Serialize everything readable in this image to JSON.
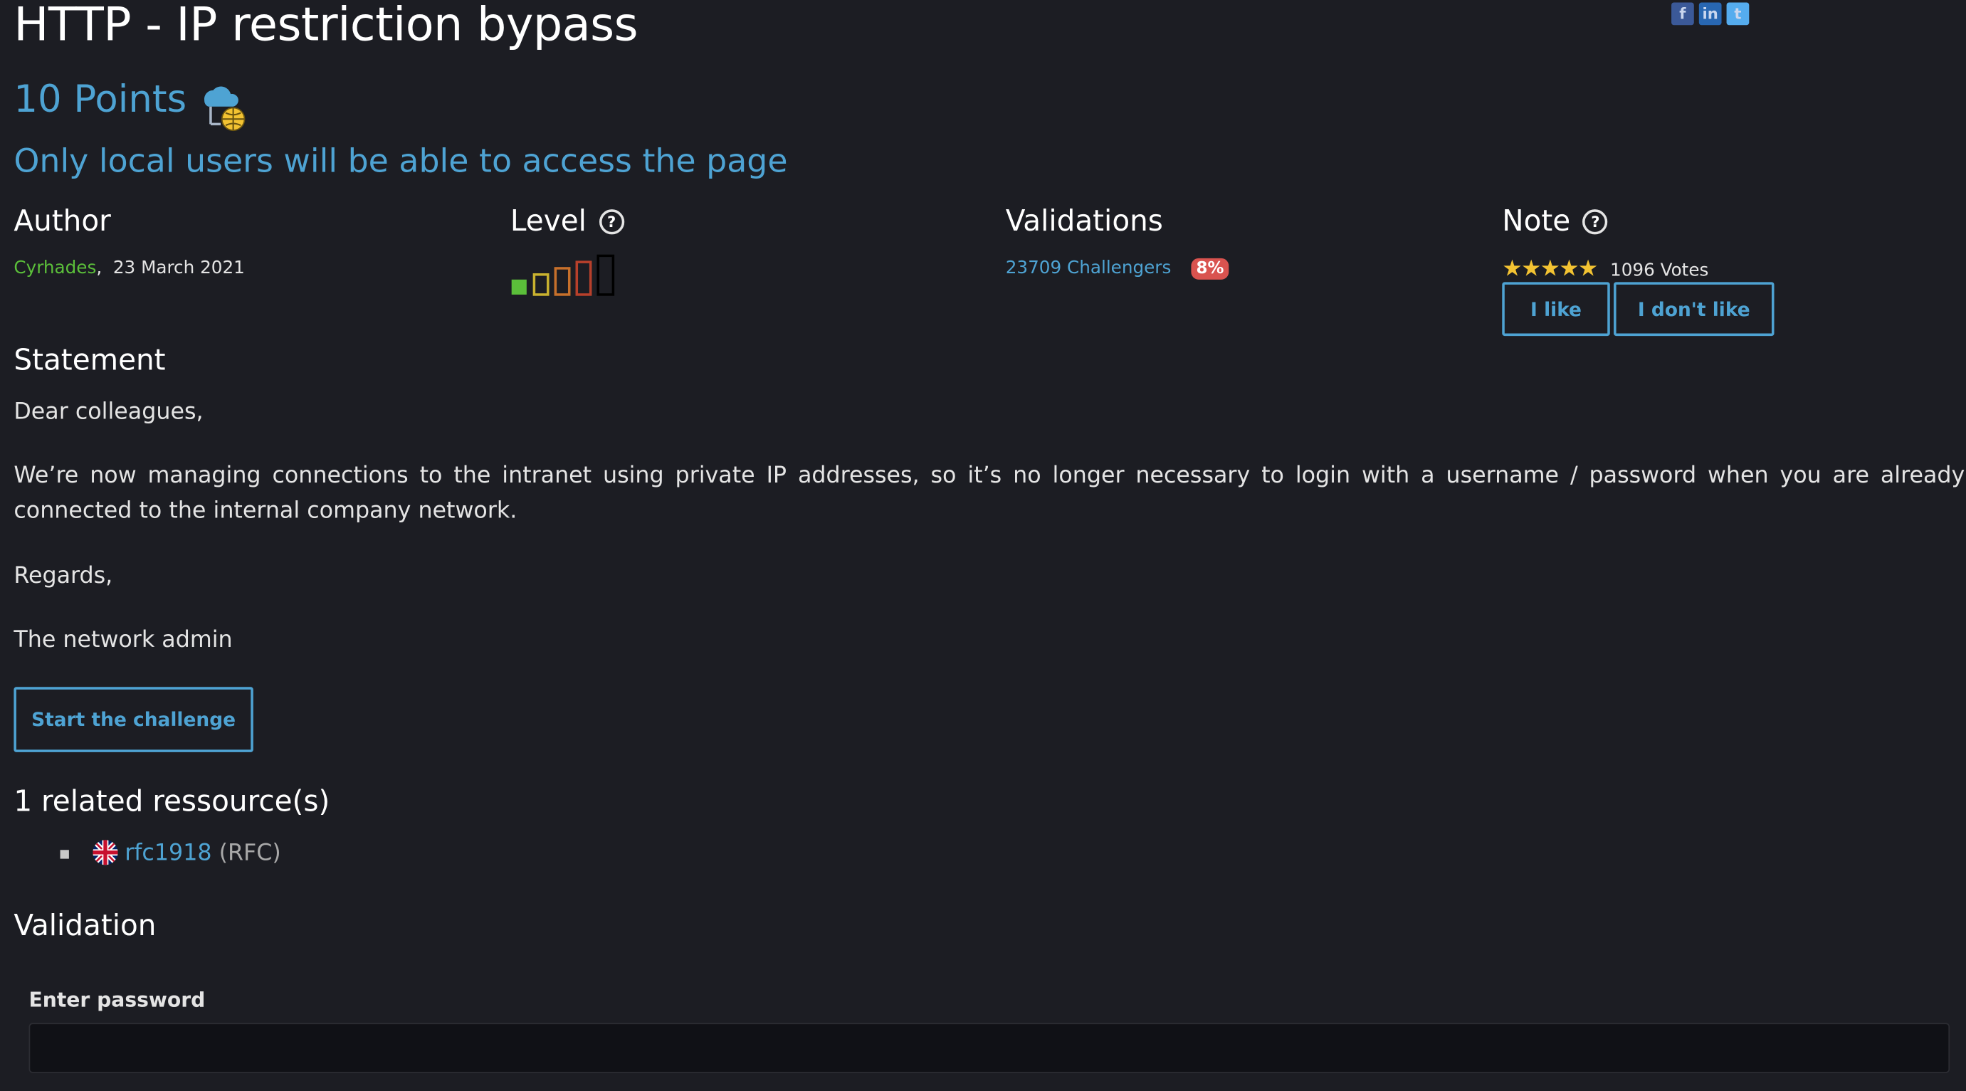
{
  "challenge": {
    "title": "HTTP - IP restriction bypass",
    "points": "10 Points",
    "subtitle": "Only local users will be able to access the page"
  },
  "author": {
    "heading": "Author",
    "name": "Cyrhades",
    "date": ",  23 March 2021"
  },
  "level": {
    "heading": "Level",
    "help_icon": "question-circle-icon",
    "value": 1,
    "max": 5
  },
  "validations": {
    "heading": "Validations",
    "challengers": "23709 Challengers",
    "percent": "8%"
  },
  "note": {
    "heading": "Note",
    "help_icon": "question-circle-icon",
    "stars": "★★★★★",
    "votes": "1096 Votes",
    "like_label": "I like",
    "dislike_label": "I don't like"
  },
  "statement": {
    "heading": "Statement",
    "greeting": "Dear colleagues,",
    "paragraph": "We’re now managing connections to the intranet using private IP addresses, so it’s no longer necessary to login with a username / password when you are already connected to the internal company network.",
    "regards": "Regards,",
    "signature": "The network admin"
  },
  "start_button": "Start the challenge",
  "resources": {
    "heading": "1 related ressource(s)",
    "items": [
      {
        "flag": "uk-flag-icon",
        "link": "rfc1918",
        "type": "(RFC)"
      }
    ]
  },
  "validation": {
    "heading": "Validation",
    "label": "Enter password",
    "value": ""
  },
  "colors": {
    "background": "#1c1d23",
    "accent": "#4ea3d3",
    "author_green": "#5bbf3a",
    "badge_red": "#d9534f",
    "star_yellow": "#f3c332"
  }
}
